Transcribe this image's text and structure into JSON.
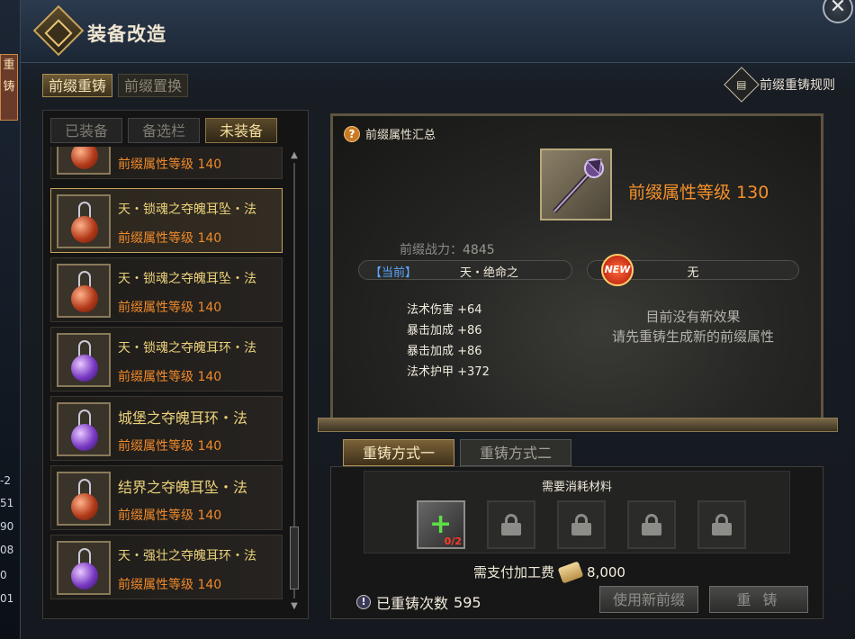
{
  "window": {
    "title": "装备改造"
  },
  "top_tabs": [
    {
      "label": "前缀重铸",
      "active": true
    },
    {
      "label": "前缀置换",
      "active": false
    }
  ],
  "rules_label": "前缀重铸规则",
  "rules_icon": "document-icon",
  "sub_tabs": [
    {
      "label": "已装备",
      "active": false
    },
    {
      "label": "备选栏",
      "active": false
    },
    {
      "label": "未装备",
      "active": true
    }
  ],
  "items": [
    {
      "name": "",
      "level": "前缀属性等级 140",
      "gem": "red"
    },
    {
      "name": "天・锁魂之夺魄耳坠・法",
      "level": "前缀属性等级 140",
      "gem": "red",
      "selected": true
    },
    {
      "name": "天・锁魂之夺魄耳坠・法",
      "level": "前缀属性等级 140",
      "gem": "red"
    },
    {
      "name": "天・锁魂之夺魄耳环・法",
      "level": "前缀属性等级 140",
      "gem": "purple"
    },
    {
      "name": "城堡之夺魄耳环・法",
      "level": "前缀属性等级 140",
      "gem": "purple"
    },
    {
      "name": "结界之夺魄耳坠・法",
      "level": "前缀属性等级 140",
      "gem": "red"
    },
    {
      "name": "天・强壮之夺魄耳环・法",
      "level": "前缀属性等级 140",
      "gem": "purple"
    }
  ],
  "preview": {
    "summary_label": "前缀属性汇总",
    "prefix_level": "前缀属性等级 130",
    "combat_label": "前缀战力：",
    "combat_value": "4845",
    "current_tag": "【当前】",
    "current_name": "天・绝命之",
    "new_badge": "NEW",
    "new_value": "无",
    "stats": [
      "法术伤害 +64",
      "暴击加成 +86",
      "暴击加成 +86",
      "法术护甲 +372"
    ],
    "no_effect_line1": "目前没有新效果",
    "no_effect_line2": "请先重铸生成新的前缀属性"
  },
  "method_tabs": [
    {
      "label": "重铸方式一",
      "active": true
    },
    {
      "label": "重铸方式二",
      "active": false
    }
  ],
  "materials": {
    "title": "需要消耗材料",
    "first_count": "0/2",
    "locked_slots": 4
  },
  "fee": {
    "label": "需支付加工费",
    "value": "8,000"
  },
  "recast_count": {
    "label": "已重铸次数",
    "value": "595"
  },
  "buttons": {
    "use_new": "使用新前缀",
    "recast": "重 铸"
  },
  "background_strip": {
    "tabs": [
      "重",
      "铸"
    ],
    "numbers": [
      "-2",
      "51",
      "90",
      "08",
      "0",
      "01"
    ]
  }
}
